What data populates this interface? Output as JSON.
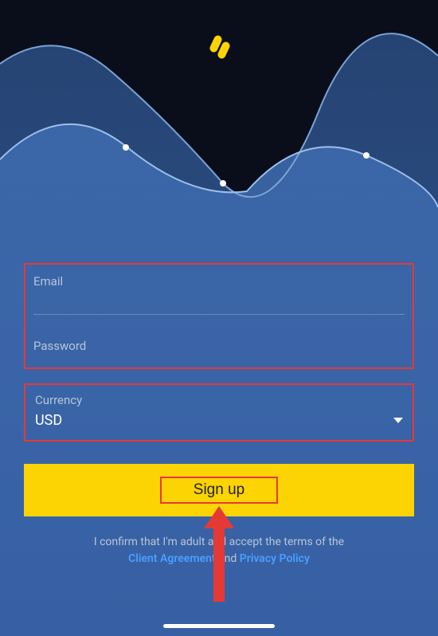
{
  "form": {
    "email_label": "Email",
    "password_label": "Password",
    "currency_label": "Currency",
    "currency_value": "USD"
  },
  "signup_button": "Sign up",
  "terms": {
    "prefix": "I confirm that I'm adult and accept the terms of the",
    "link1": "Client Agreement",
    "middle": " and ",
    "link2": "Privacy Policy"
  }
}
